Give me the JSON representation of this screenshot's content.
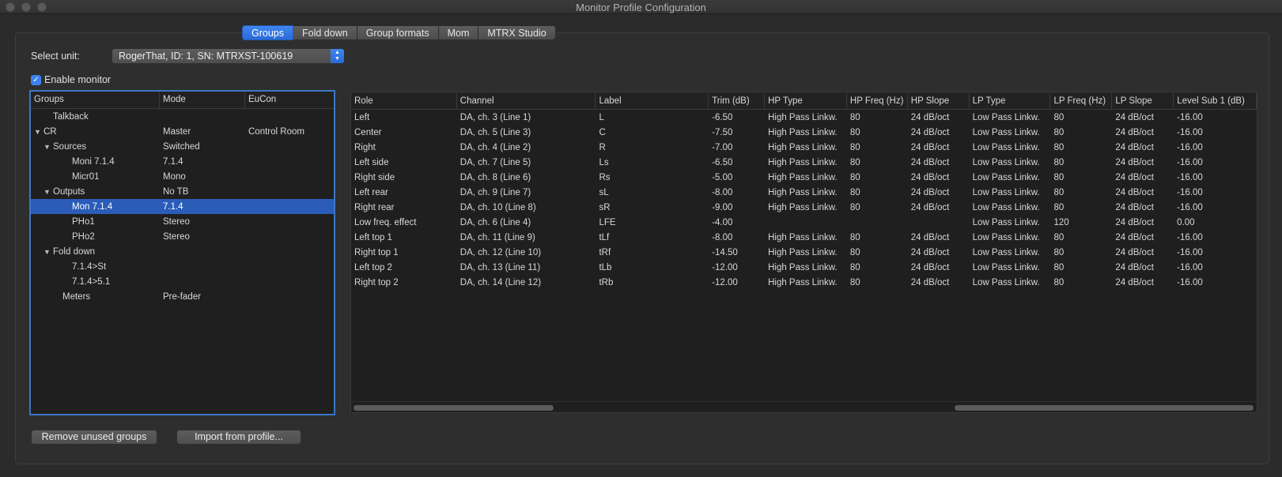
{
  "window": {
    "title": "Monitor Profile Configuration"
  },
  "tabs": [
    {
      "label": "Groups",
      "active": true
    },
    {
      "label": "Fold down"
    },
    {
      "label": "Group formats"
    },
    {
      "label": "Mom"
    },
    {
      "label": "MTRX Studio"
    }
  ],
  "unit": {
    "label": "Select unit:",
    "value": "RogerThat, ID: 1, SN: MTRXST-100619"
  },
  "enable_monitor": {
    "label": "Enable monitor",
    "checked": true
  },
  "tree": {
    "headers": [
      "Groups",
      "Mode",
      "EuCon"
    ],
    "rows": [
      {
        "name": "Talkback",
        "mode": "",
        "eucon": "",
        "indent": 1,
        "expander": ""
      },
      {
        "name": "CR",
        "mode": "Master",
        "eucon": "Control Room",
        "indent": 0,
        "expander": "▼"
      },
      {
        "name": "Sources",
        "mode": "Switched",
        "eucon": "",
        "indent": 1,
        "expander": "▼"
      },
      {
        "name": "Moni 7.1.4",
        "mode": "7.1.4",
        "eucon": "",
        "indent": 3,
        "expander": ""
      },
      {
        "name": "Micr01",
        "mode": "Mono",
        "eucon": "",
        "indent": 3,
        "expander": ""
      },
      {
        "name": "Outputs",
        "mode": "No TB",
        "eucon": "",
        "indent": 1,
        "expander": "▼"
      },
      {
        "name": "Mon 7.1.4",
        "mode": "7.1.4",
        "eucon": "",
        "indent": 3,
        "expander": "",
        "selected": true
      },
      {
        "name": "PHo1",
        "mode": "Stereo",
        "eucon": "",
        "indent": 3,
        "expander": ""
      },
      {
        "name": "PHo2",
        "mode": "Stereo",
        "eucon": "",
        "indent": 3,
        "expander": ""
      },
      {
        "name": "Fold down",
        "mode": "",
        "eucon": "",
        "indent": 1,
        "expander": "▼"
      },
      {
        "name": "7.1.4>St",
        "mode": "",
        "eucon": "",
        "indent": 3,
        "expander": ""
      },
      {
        "name": "7.1.4>5.1",
        "mode": "",
        "eucon": "",
        "indent": 3,
        "expander": ""
      },
      {
        "name": "Meters",
        "mode": "Pre-fader",
        "eucon": "",
        "indent": 2,
        "expander": ""
      }
    ]
  },
  "grid": {
    "headers": [
      "Role",
      "Channel",
      "Label",
      "Trim (dB)",
      "HP Type",
      "HP Freq (Hz)",
      "HP Slope",
      "LP Type",
      "LP Freq (Hz)",
      "LP Slope",
      "Level Sub 1 (dB)"
    ],
    "rows": [
      [
        "Left",
        "DA, ch. 3 (Line 1)",
        "L",
        "-6.50",
        "High Pass Linkw.",
        "80",
        "24 dB/oct",
        "Low Pass Linkw.",
        "80",
        "24 dB/oct",
        "-16.00"
      ],
      [
        "Center",
        "DA, ch. 5 (Line 3)",
        "C",
        "-7.50",
        "High Pass Linkw.",
        "80",
        "24 dB/oct",
        "Low Pass Linkw.",
        "80",
        "24 dB/oct",
        "-16.00"
      ],
      [
        "Right",
        "DA, ch. 4 (Line 2)",
        "R",
        "-7.00",
        "High Pass Linkw.",
        "80",
        "24 dB/oct",
        "Low Pass Linkw.",
        "80",
        "24 dB/oct",
        "-16.00"
      ],
      [
        "Left side",
        "DA, ch. 7 (Line 5)",
        "Ls",
        "-6.50",
        "High Pass Linkw.",
        "80",
        "24 dB/oct",
        "Low Pass Linkw.",
        "80",
        "24 dB/oct",
        "-16.00"
      ],
      [
        "Right side",
        "DA, ch. 8 (Line 6)",
        "Rs",
        "-5.00",
        "High Pass Linkw.",
        "80",
        "24 dB/oct",
        "Low Pass Linkw.",
        "80",
        "24 dB/oct",
        "-16.00"
      ],
      [
        "Left rear",
        "DA, ch. 9 (Line 7)",
        "sL",
        "-8.00",
        "High Pass Linkw.",
        "80",
        "24 dB/oct",
        "Low Pass Linkw.",
        "80",
        "24 dB/oct",
        "-16.00"
      ],
      [
        "Right rear",
        "DA, ch. 10 (Line 8)",
        "sR",
        "-9.00",
        "High Pass Linkw.",
        "80",
        "24 dB/oct",
        "Low Pass Linkw.",
        "80",
        "24 dB/oct",
        "-16.00"
      ],
      [
        "Low freq. effect",
        "DA, ch. 6 (Line 4)",
        "LFE",
        "-4.00",
        "",
        "",
        "",
        "Low Pass Linkw.",
        "120",
        "24 dB/oct",
        "0.00"
      ],
      [
        "Left top 1",
        "DA, ch. 11 (Line 9)",
        "tLf",
        "-8.00",
        "High Pass Linkw.",
        "80",
        "24 dB/oct",
        "Low Pass Linkw.",
        "80",
        "24 dB/oct",
        "-16.00"
      ],
      [
        "Right top 1",
        "DA, ch. 12 (Line 10)",
        "tRf",
        "-14.50",
        "High Pass Linkw.",
        "80",
        "24 dB/oct",
        "Low Pass Linkw.",
        "80",
        "24 dB/oct",
        "-16.00"
      ],
      [
        "Left top 2",
        "DA, ch. 13 (Line 11)",
        "tLb",
        "-12.00",
        "High Pass Linkw.",
        "80",
        "24 dB/oct",
        "Low Pass Linkw.",
        "80",
        "24 dB/oct",
        "-16.00"
      ],
      [
        "Right top 2",
        "DA, ch. 14 (Line 12)",
        "tRb",
        "-12.00",
        "High Pass Linkw.",
        "80",
        "24 dB/oct",
        "Low Pass Linkw.",
        "80",
        "24 dB/oct",
        "-16.00"
      ]
    ]
  },
  "buttons": {
    "remove": "Remove unused groups",
    "import": "Import from profile..."
  },
  "colors": {
    "accent": "#2a6ad8",
    "selection": "#2a5cb8",
    "focus_ring": "#3c77c4"
  },
  "icons": {
    "unit_stepper": "chevron-up-down-icon",
    "expander": "disclosure-triangle-icon",
    "checkbox": "checkmark-icon"
  }
}
